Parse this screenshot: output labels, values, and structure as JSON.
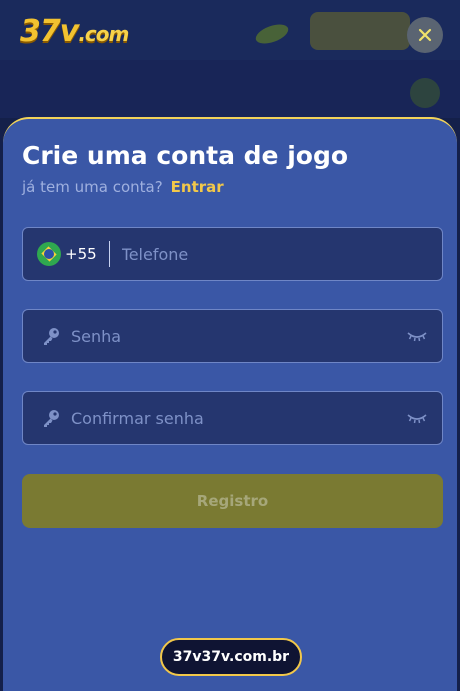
{
  "background": {
    "logo_main": "37v",
    "logo_suffix": ".com"
  },
  "modal": {
    "title": "Crie uma conta de jogo",
    "subtitle": "já tem uma conta?",
    "login_link": "Entrar",
    "phone": {
      "country_code": "+55",
      "placeholder": "Telefone",
      "flag_icon": "brazil-flag-icon"
    },
    "password": {
      "placeholder": "Senha",
      "icon": "key-icon",
      "toggle_icon": "eye-closed-icon"
    },
    "confirm_password": {
      "placeholder": "Confirmar senha",
      "icon": "key-icon",
      "toggle_icon": "eye-closed-icon"
    },
    "register_label": "Registro",
    "domain_badge": "37v37v.com.br",
    "close_icon": "close-icon"
  },
  "colors": {
    "sheet_bg": "#3a57a6",
    "accent_yellow": "#f2c84a",
    "input_bg": "#25366f",
    "button_disabled": "#7a7a32"
  }
}
